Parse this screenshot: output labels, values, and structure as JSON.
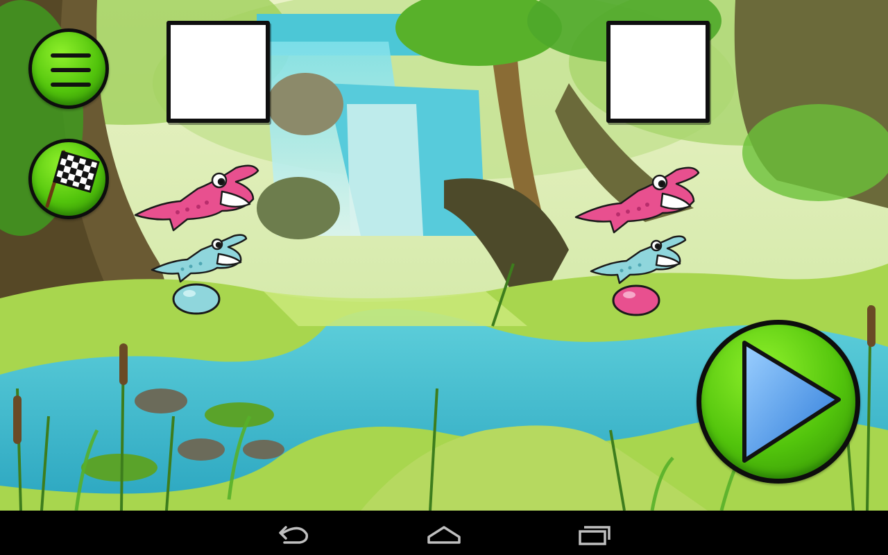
{
  "game": {
    "menu_button": {
      "icon": "hamburger-menu-icon"
    },
    "finish_button": {
      "icon": "checkered-flag-icon"
    },
    "play_button": {
      "icon": "play-triangle-icon"
    },
    "card_slots": [
      {
        "side": "left",
        "state": "empty"
      },
      {
        "side": "right",
        "state": "empty"
      }
    ],
    "left_group": {
      "crocodiles": [
        "pink",
        "blue"
      ],
      "egg": "blue"
    },
    "right_group": {
      "crocodiles": [
        "pink",
        "blue"
      ],
      "egg": "pink"
    }
  },
  "colors": {
    "button_green": "#55c80d",
    "play_arrow_blue": "#3a8fe8",
    "croc_pink": "#e8508f",
    "croc_blue": "#8fd6dc",
    "egg_blue": "#8fd6dc",
    "egg_pink": "#e8508f"
  },
  "navbar": {
    "back": "back-arrow-icon",
    "home": "home-icon",
    "recents": "recent-apps-icon"
  }
}
